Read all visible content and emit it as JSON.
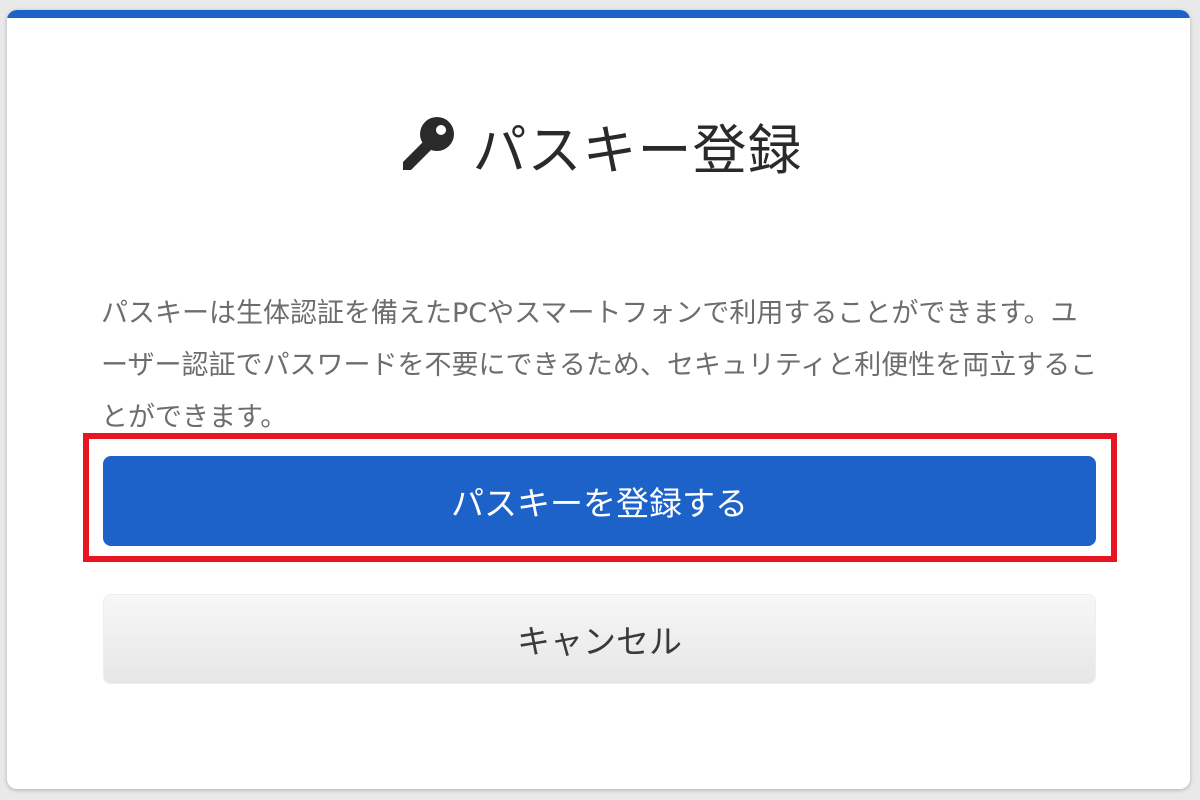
{
  "dialog": {
    "title": "パスキー登録",
    "title_icon": "key-icon",
    "description": "パスキーは生体認証を備えたPCやスマートフォンで利用することができます。ユーザー認証でパスワードを不要にできるため、セキュリティと利便性を両立することができます。",
    "register_button_label": "パスキーを登録する",
    "cancel_button_label": "キャンセル"
  },
  "colors": {
    "accent": "#1c62c9",
    "highlight": "#e8141f"
  }
}
